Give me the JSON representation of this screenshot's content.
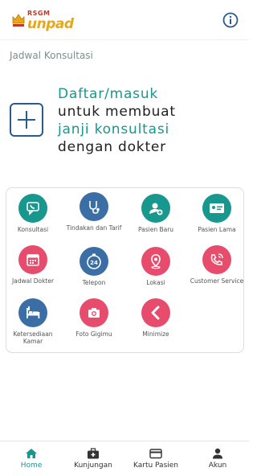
{
  "header": {
    "logo_top": "RSGM",
    "logo_main": "unpad",
    "info_icon": "info-icon"
  },
  "section": {
    "title": "Jadwal Konsultasi"
  },
  "cta": {
    "line1": "Daftar/masuk",
    "line2": "untuk membuat",
    "line3": "janji konsultasi",
    "line4": "dengan dokter",
    "icon": "plus-icon"
  },
  "menu": [
    {
      "label": "Konsultasi",
      "icon": "chat-phone-icon",
      "color": "#17978d"
    },
    {
      "label": "Tindakan dan Tarif",
      "icon": "stethoscope-icon",
      "color": "#3b6ea5"
    },
    {
      "label": "Pasien Baru",
      "icon": "add-user-icon",
      "color": "#17978d"
    },
    {
      "label": "Pasien Lama",
      "icon": "id-card-icon",
      "color": "#17978d"
    },
    {
      "label": "Jadwal Dokter",
      "icon": "calendar-icon",
      "color": "#e74c6c"
    },
    {
      "label": "Telepon",
      "icon": "clock-24-icon",
      "color": "#3b6ea5"
    },
    {
      "label": "Lokasi",
      "icon": "location-pin-icon",
      "color": "#e74c6c"
    },
    {
      "label": "Customer Service",
      "icon": "phone-call-icon",
      "color": "#e74c6c"
    },
    {
      "label": "Ketersediaan Kamar",
      "icon": "hospital-bed-icon",
      "color": "#3b6ea5"
    },
    {
      "label": "Foto Gigimu",
      "icon": "camera-icon",
      "color": "#e74c6c"
    },
    {
      "label": "Minimize",
      "icon": "chevron-left-icon",
      "color": "#e74c6c"
    }
  ],
  "nav": [
    {
      "label": "Home",
      "icon": "home-icon",
      "active": true
    },
    {
      "label": "Kunjungan",
      "icon": "medical-bag-icon",
      "active": false
    },
    {
      "label": "Kartu Pasien",
      "icon": "credit-card-icon",
      "active": false
    },
    {
      "label": "Akun",
      "icon": "user-icon",
      "active": false
    }
  ],
  "colors": {
    "teal": "#17978d",
    "blue": "#3b6ea5",
    "pink": "#e74c6c",
    "navy": "#2a5b8c"
  }
}
